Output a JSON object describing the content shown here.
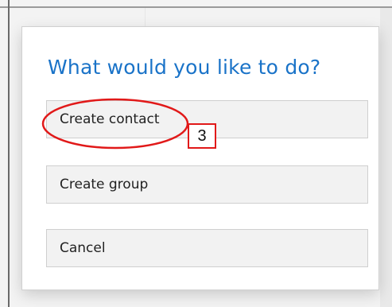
{
  "dialog": {
    "title": "What would you like to do?",
    "actions": [
      {
        "label": "Create contact"
      },
      {
        "label": "Create group"
      },
      {
        "label": "Cancel"
      }
    ]
  },
  "annotation": {
    "step_number": "3",
    "highlight_color": "#e11919"
  },
  "colors": {
    "title": "#1a73c8",
    "button_background": "#f2f2f2",
    "button_border": "#cfcfcf"
  }
}
